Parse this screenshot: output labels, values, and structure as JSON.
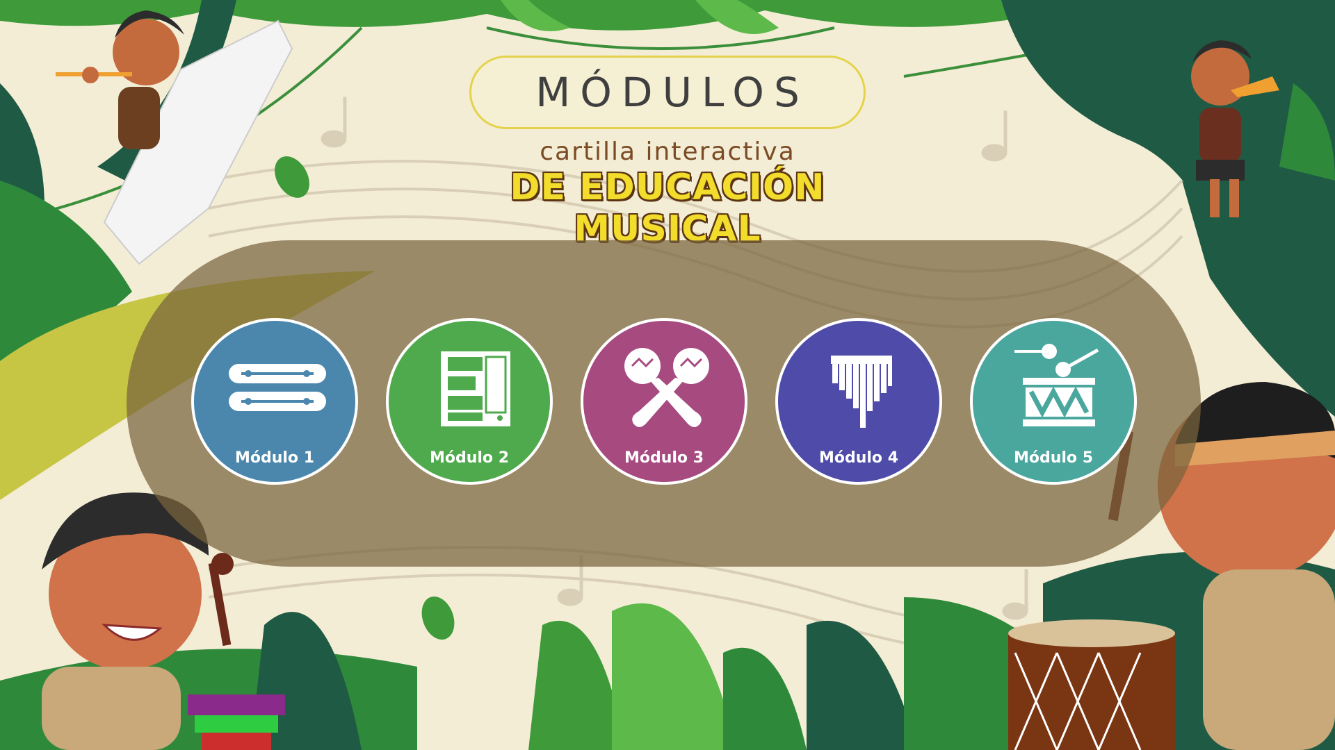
{
  "header": {
    "title": "MÓDULOS",
    "subtitle": "cartilla interactiva",
    "headline": "DE EDUCACIÓN MUSICAL"
  },
  "modules": [
    {
      "label": "Módulo 1",
      "color": "#4b87ad",
      "icon": "xylophone-bars-icon"
    },
    {
      "label": "Módulo 2",
      "color": "#4eaa4c",
      "icon": "piano-keys-icon"
    },
    {
      "label": "Módulo 3",
      "color": "#a64a80",
      "icon": "maracas-icon"
    },
    {
      "label": "Módulo 4",
      "color": "#4f4ba9",
      "icon": "pan-flute-icon"
    },
    {
      "label": "Módulo 5",
      "color": "#4aa79d",
      "icon": "drum-icon"
    }
  ],
  "colors": {
    "background": "#f4edd6",
    "panel": "#786440",
    "title_border": "#e4d34a",
    "headline": "#f2dc2c"
  }
}
